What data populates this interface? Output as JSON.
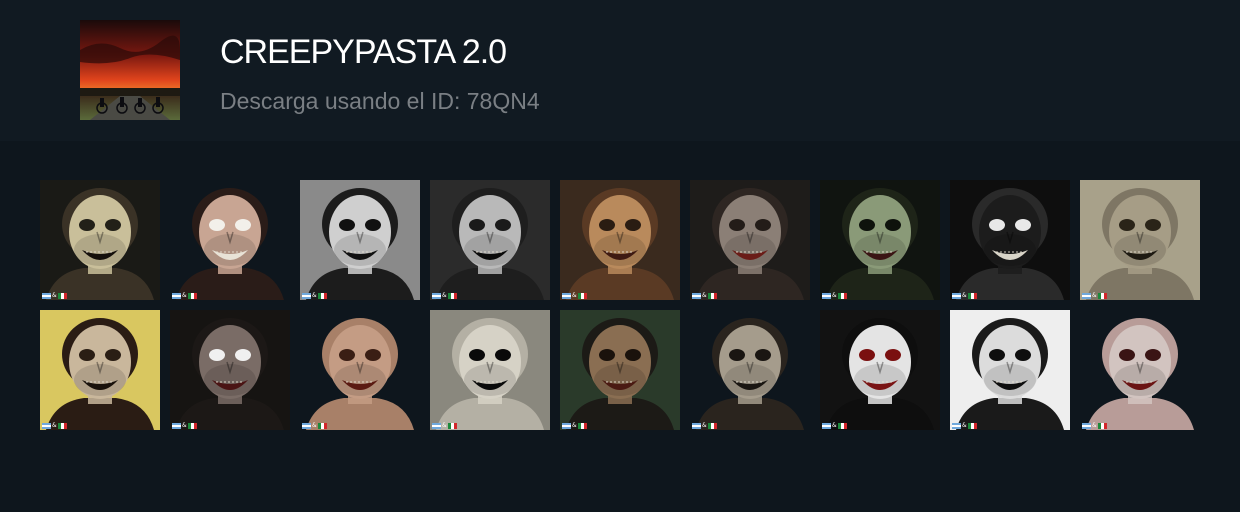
{
  "header": {
    "title": "CREEPYPASTA 2.0",
    "subtitle": "Descarga usando el ID: 78QN4",
    "cover_icon": "night-road-kids-bicycles-image"
  },
  "sticker_badge": {
    "separator": "&",
    "flags": [
      "argentina-flag-icon",
      "mexico-flag-icon"
    ]
  },
  "colors": {
    "page_background": "#0e161d",
    "header_background": "#111a22",
    "title": "#ffffff",
    "subtitle": "#7a7f84"
  },
  "stickers": [
    {
      "icon": "grinning-ghoul-face",
      "skin": "#c9bf9a",
      "bg": "#1a1a16",
      "eyes": "#222018",
      "mouth": "#15100c",
      "hair": "#3a3226"
    },
    {
      "icon": "wide-smile-joker-face",
      "skin": "#c8a593",
      "bg": "#0e161d",
      "eyes": "#f2f0ea",
      "mouth": "#e8e2d6",
      "hair": "#2a1c18"
    },
    {
      "icon": "black-white-skull-child",
      "skin": "#cfcfcf",
      "bg": "#8a8a8a",
      "eyes": "#111111",
      "mouth": "#111111",
      "hair": "#1c1c1c"
    },
    {
      "icon": "screaming-pale-man",
      "skin": "#b9b9b9",
      "bg": "#2b2b2b",
      "eyes": "#1a1a1a",
      "mouth": "#0a0a0a",
      "hair": "#1e1e1e"
    },
    {
      "icon": "rotting-zombie-face",
      "skin": "#b98a5c",
      "bg": "#3a2a1e",
      "eyes": "#2a1c12",
      "mouth": "#3e1a12",
      "hair": "#5a3a24"
    },
    {
      "icon": "bloody-zombie-woman",
      "skin": "#8b7f76",
      "bg": "#1e1c1a",
      "eyes": "#231c18",
      "mouth": "#6a1c18",
      "hair": "#2e2622"
    },
    {
      "icon": "green-ghoul-face",
      "skin": "#8a9a78",
      "bg": "#101410",
      "eyes": "#0e120c",
      "mouth": "#3a1414",
      "hair": "#1e2418"
    },
    {
      "icon": "long-hair-smiling-creature",
      "skin": "#1c1c1c",
      "bg": "#0e0e0e",
      "eyes": "#e8e8e8",
      "mouth": "#d8d4c8",
      "hair": "#2a2a2a"
    },
    {
      "icon": "hooded-mummy-figure",
      "skin": "#a69d86",
      "bg": "#a8a18a",
      "eyes": "#2a2418",
      "mouth": "#1e1a12",
      "hair": "#7e7664"
    },
    {
      "icon": "screaming-woman-face",
      "skin": "#c9b79c",
      "bg": "#d9c760",
      "eyes": "#2a1e14",
      "mouth": "#1a120c",
      "hair": "#2a1c14"
    },
    {
      "icon": "half-face-ghoul",
      "skin": "#7a6c66",
      "bg": "#161412",
      "eyes": "#f0f0f0",
      "mouth": "#4a1414",
      "hair": "#1c1816"
    },
    {
      "icon": "bald-fanged-monster",
      "skin": "#c49c84",
      "bg": "#0e161d",
      "eyes": "#3a1e14",
      "mouth": "#5a1a12",
      "hair": "#a88068"
    },
    {
      "icon": "hands-screaming-ghost",
      "skin": "#d6d2c6",
      "bg": "#8a887e",
      "eyes": "#0a0a0a",
      "mouth": "#0a0a0a",
      "hair": "#b4b0a4"
    },
    {
      "icon": "torn-face-zombie-man",
      "skin": "#8a6e52",
      "bg": "#2a3a2a",
      "eyes": "#1a120c",
      "mouth": "#4a1a12",
      "hair": "#1c1a16"
    },
    {
      "icon": "crawling-ghost-girl",
      "skin": "#a59c8c",
      "bg": "#0e161d",
      "eyes": "#1a1612",
      "mouth": "#1a1612",
      "hair": "#2a241e"
    },
    {
      "icon": "white-face-red-eyes",
      "skin": "#e4e4e4",
      "bg": "#121212",
      "eyes": "#7a1010",
      "mouth": "#7a1414",
      "hair": "#0e0e0e"
    },
    {
      "icon": "hooded-grin-jeff",
      "skin": "#dcdcdc",
      "bg": "#eeeeee",
      "eyes": "#0e0e0e",
      "mouth": "#0e0e0e",
      "hair": "#1a1a1a"
    },
    {
      "icon": "bloody-long-neck-creature",
      "skin": "#d2c4c0",
      "bg": "#0e161d",
      "eyes": "#3a1414",
      "mouth": "#6a1414",
      "hair": "#b89c98"
    }
  ]
}
